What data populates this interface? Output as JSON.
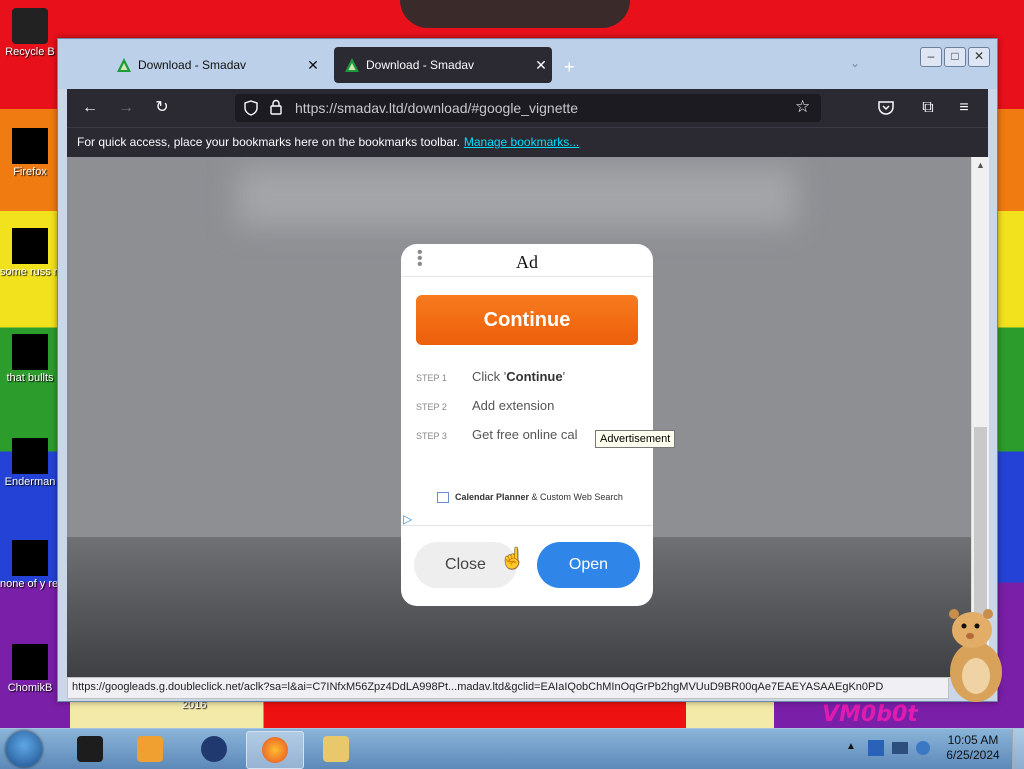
{
  "desktop": {
    "icons": [
      {
        "label": "Recycle B"
      },
      {
        "label": "Firefox"
      },
      {
        "label": "some russ ran a ra"
      },
      {
        "label": "that bullts"
      },
      {
        "label": "Enderman"
      },
      {
        "label": "none of y retards kn"
      },
      {
        "label": "ChomikB"
      }
    ],
    "watermark": "VM0b0t",
    "year_label": "2016"
  },
  "browser": {
    "tabs": [
      {
        "title": "Download - Smadav",
        "close": "✕",
        "active": false
      },
      {
        "title": "Download - Smadav",
        "close": "✕",
        "active": true
      }
    ],
    "new_tab": "+",
    "window_buttons": {
      "minimize": "–",
      "maximize": "□",
      "close": "✕"
    },
    "url": "https://smadav.ltd/download/#google_vignette",
    "bookmarks_bar": {
      "message": "For quick access, place your bookmarks here on the bookmarks toolbar.",
      "link": "Manage bookmarks..."
    },
    "status_url": "https://googleads.g.doubleclick.net/aclk?sa=l&ai=C7INfxM56Zpz4DdLA998Pt...madav.ltd&gclid=EAIaIQobChMInOqGrPb2hgMVUuD9BR00qAe7EAEYASAAEgKn0PD"
  },
  "ad": {
    "title": "Ad",
    "continue_label": "Continue",
    "steps": [
      {
        "num": "STEP 1",
        "prefix": "Click '",
        "bold": "Continue",
        "suffix": "'"
      },
      {
        "num": "STEP 2",
        "text": "Add extension"
      },
      {
        "num": "STEP 3",
        "text": "Get free online cal"
      }
    ],
    "brand_bold": "Calendar Planner",
    "brand_rest": " & Custom Web Search",
    "close_label": "Close",
    "open_label": "Open",
    "tooltip": "Advertisement"
  },
  "taskbar": {
    "time": "10:05 AM",
    "date": "6/25/2024"
  },
  "colors": {
    "accent_orange": "#f77b1e",
    "open_blue": "#2f86e8",
    "link_cyan": "#00ddff"
  }
}
